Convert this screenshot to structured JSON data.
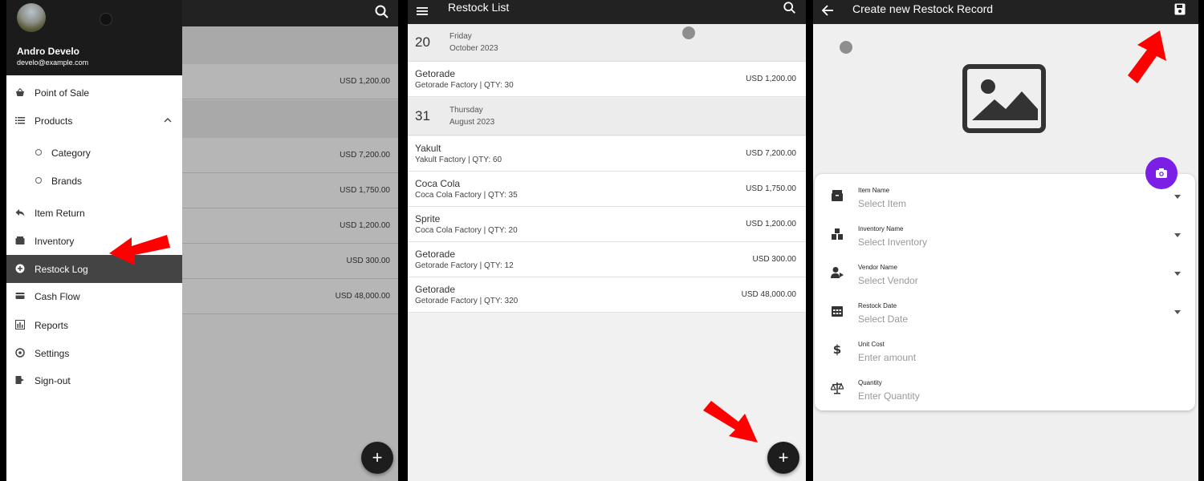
{
  "panel1": {
    "background_amounts": [
      "USD 1,200.00",
      "USD 7,200.00",
      "USD 1,750.00",
      "USD 1,200.00",
      "USD 300.00",
      "USD 48,000.00"
    ],
    "fab_label": "+",
    "drawer": {
      "user_name": "Andro Develo",
      "user_email": "develo@example.com",
      "items": [
        {
          "label": "Point of Sale",
          "icon": "basket-icon"
        },
        {
          "label": "Products",
          "icon": "list-icon"
        },
        {
          "label": "Category",
          "icon": "circle-icon"
        },
        {
          "label": "Brands",
          "icon": "circle-icon"
        },
        {
          "label": "Item Return",
          "icon": "reply-icon"
        },
        {
          "label": "Inventory",
          "icon": "box-icon"
        },
        {
          "label": "Restock Log",
          "icon": "plus-circle-icon"
        },
        {
          "label": "Cash Flow",
          "icon": "card-icon"
        },
        {
          "label": "Reports",
          "icon": "bar-chart-icon"
        },
        {
          "label": "Settings",
          "icon": "settings-icon"
        },
        {
          "label": "Sign-out",
          "icon": "sign-out-icon"
        }
      ],
      "active_item": "Restock Log"
    }
  },
  "panel2": {
    "title": "Restock List",
    "fab_label": "+",
    "groups": [
      {
        "day_num": "20",
        "weekday": "Friday",
        "month_year": "October 2023",
        "records": [
          {
            "name": "Getorade",
            "sub": "Getorade Factory | QTY: 30",
            "amount": "USD 1,200.00"
          }
        ]
      },
      {
        "day_num": "31",
        "weekday": "Thursday",
        "month_year": "August 2023",
        "records": [
          {
            "name": "Yakult",
            "sub": "Yakult Factory | QTY: 60",
            "amount": "USD 7,200.00"
          },
          {
            "name": "Coca Cola",
            "sub": "Coca Cola Factory | QTY: 35",
            "amount": "USD 1,750.00"
          },
          {
            "name": "Sprite",
            "sub": "Coca Cola Factory | QTY: 20",
            "amount": "USD 1,200.00"
          },
          {
            "name": "Getorade",
            "sub": "Getorade Factory | QTY: 12",
            "amount": "USD 300.00"
          },
          {
            "name": "Getorade",
            "sub": "Getorade Factory | QTY: 320",
            "amount": "USD 48,000.00"
          }
        ]
      }
    ]
  },
  "panel3": {
    "title": "Create new Restock Record",
    "fields": [
      {
        "label": "Item Name",
        "placeholder": "Select Item",
        "icon": "box-icon",
        "dropdown": true
      },
      {
        "label": "Inventory Name",
        "placeholder": "Select Inventory",
        "icon": "boxes-icon",
        "dropdown": true
      },
      {
        "label": "Vendor Name",
        "placeholder": "Select Vendor",
        "icon": "vendor-icon",
        "dropdown": true
      },
      {
        "label": "Restock Date",
        "placeholder": "Select Date",
        "icon": "calendar-icon",
        "dropdown": true
      },
      {
        "label": "Unit Cost",
        "placeholder": "Enter amount",
        "icon": "dollar-icon",
        "dropdown": false
      },
      {
        "label": "Quantity",
        "placeholder": "Enter Quantity",
        "icon": "scale-icon",
        "dropdown": false
      }
    ]
  },
  "colors": {
    "appbar": "#222222",
    "accent_purple": "#7b1fe6",
    "annotation_arrow": "#ff0000",
    "active_menu": "#444444"
  }
}
